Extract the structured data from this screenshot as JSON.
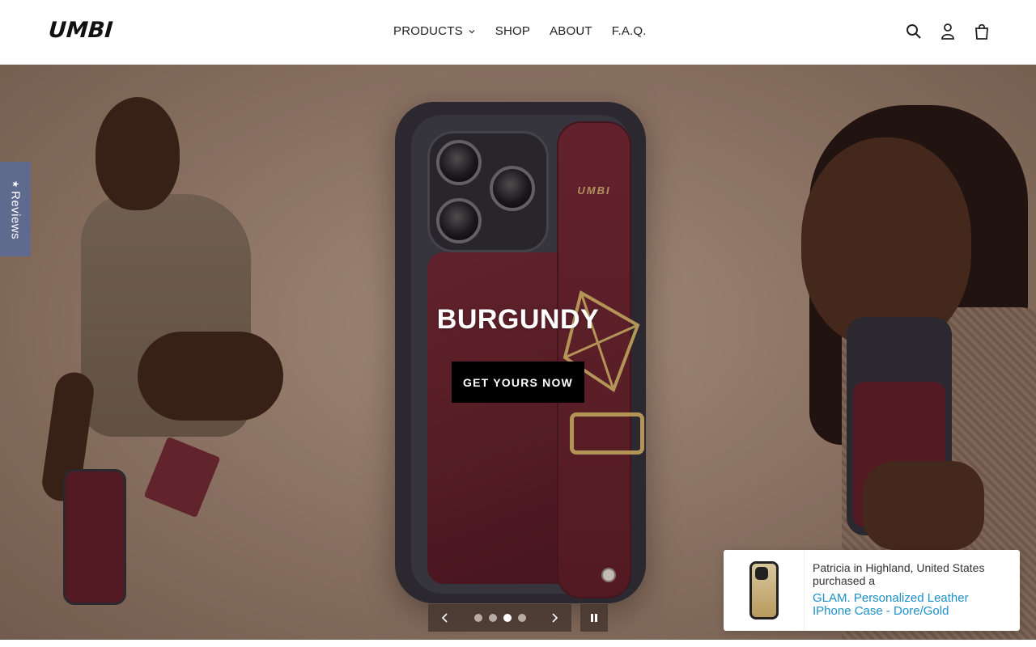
{
  "header": {
    "logo": "UMBI",
    "nav": [
      {
        "label": "PRODUCTS"
      },
      {
        "label": "SHOP"
      },
      {
        "label": "ABOUT"
      },
      {
        "label": "F.A.Q."
      }
    ],
    "icons": [
      "search-icon",
      "account-icon",
      "cart-icon"
    ]
  },
  "hero": {
    "title": "BURGUNDY",
    "cta_label": "GET YOURS NOW",
    "strap_brand": "UMBI",
    "slides": {
      "count": 4,
      "active_index": 3
    }
  },
  "reviews_tab": {
    "label": "Reviews",
    "icon": "star-icon"
  },
  "notification": {
    "buyer_text": "Patricia in Highland, United States purchased a",
    "product_text": "GLAM. Personalized Leather IPhone Case - Dore/Gold"
  },
  "colors": {
    "cta_bg": "#000000",
    "reviews_tab_bg": "#5f6a8f",
    "link": "#1c90c8",
    "leather": "#5a1c26"
  }
}
